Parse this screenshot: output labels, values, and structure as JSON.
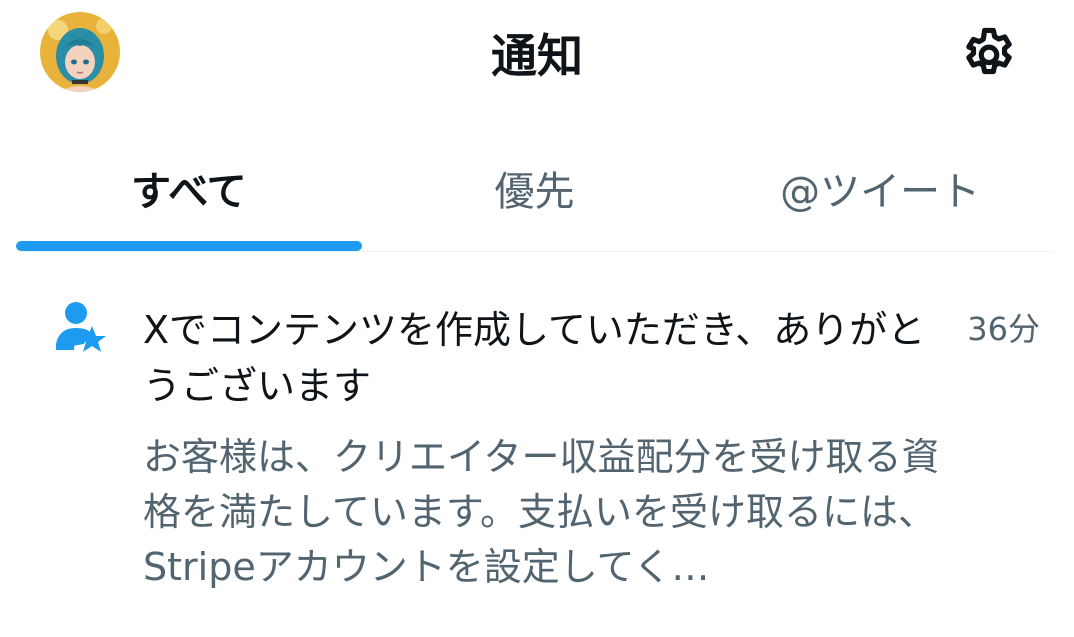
{
  "header": {
    "title": "通知",
    "avatar_icon": "user-avatar-image",
    "settings_icon": "gear-icon"
  },
  "tabs": [
    {
      "label": "すべて",
      "active": true
    },
    {
      "label": "優先",
      "active": false
    },
    {
      "label": "@ツイート",
      "active": false
    }
  ],
  "colors": {
    "accent": "#1d9bf0",
    "text_primary": "#0f1419",
    "text_secondary": "#536471"
  },
  "notification": {
    "icon": "person-star-icon",
    "title": "Xでコンテンツを作成していただき、ありがとうございます",
    "time": "36分",
    "body": "お客様は、クリエイター収益配分を受け取る資格を満たしています。支払いを受け取るには、Stripeアカウントを設定してく…"
  }
}
